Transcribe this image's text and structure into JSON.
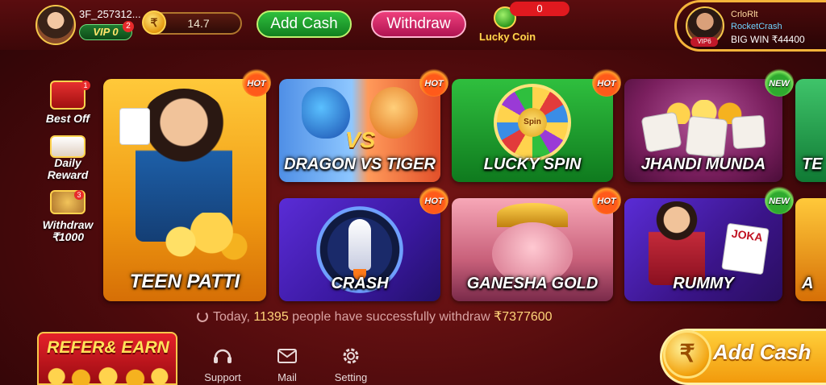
{
  "header": {
    "username": "3F_257312...",
    "vip_label": "VIP 0",
    "vip_badge": "2",
    "coin_symbol": "₹",
    "balance": "14.7",
    "add_cash": "Add Cash",
    "withdraw": "Withdraw",
    "lucky_coin_label": "Lucky Coin",
    "lucky_coin_count": "0"
  },
  "winner": {
    "name": "CrloRlt",
    "game": "RocketCrash",
    "amount": "BIG WIN ₹44400",
    "vip": "VIP6"
  },
  "side": [
    {
      "label": "Best Off",
      "badge": "1",
      "icon": "gift-icon"
    },
    {
      "label": "Daily Reward",
      "badge": "",
      "icon": "calendar-icon"
    },
    {
      "label": "Withdraw ₹1000",
      "badge": "3",
      "icon": "withdraw-icon"
    }
  ],
  "games": {
    "teen_patti": {
      "label": "TEEN PATTI",
      "tag": "HOT"
    },
    "dragon_tiger": {
      "label": "DRAGON VS TIGER",
      "tag": "HOT",
      "vs": "VS"
    },
    "lucky_spin": {
      "label": "LUCKY SPIN",
      "tag": "HOT",
      "center": "Spin"
    },
    "jhandi_munda": {
      "label": "JHANDI MUNDA",
      "tag": "NEW"
    },
    "partial_top": {
      "label": "TE"
    },
    "crash": {
      "label": "CRASH",
      "tag": "HOT"
    },
    "ganesha_gold": {
      "label": "GANESHA GOLD",
      "tag": "HOT"
    },
    "rummy": {
      "label": "RUMMY",
      "tag": "NEW",
      "cards": "JOKA"
    },
    "partial_bottom": {
      "label": "A"
    }
  },
  "ticker": {
    "prefix": "Today,",
    "count": "11395",
    "middle": "people have successfully withdraw",
    "amount": "₹7377600"
  },
  "bottom": {
    "refer": "REFER& EARN",
    "support": "Support",
    "mail": "Mail",
    "setting": "Setting",
    "add_cash": "Add Cash",
    "coin_symbol": "₹"
  },
  "colors": {
    "background": "#4c0a0c",
    "add_cash_green": "#2fbf3e",
    "withdraw_pink": "#ee3f7c",
    "gold": "#f5b43a"
  }
}
